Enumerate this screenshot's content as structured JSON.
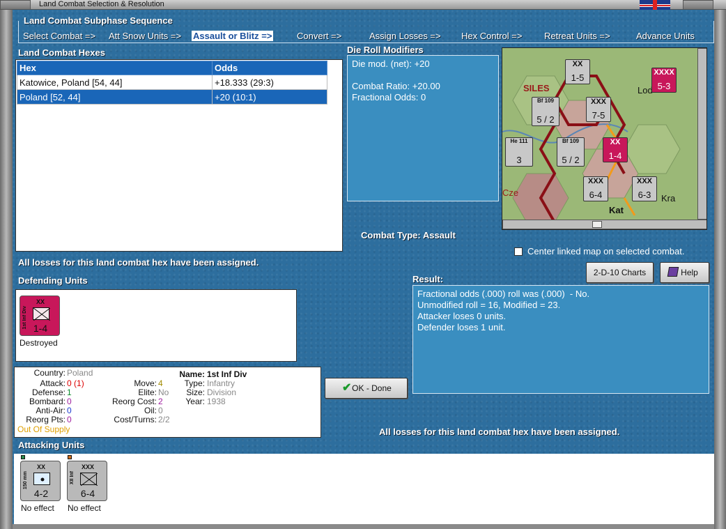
{
  "window": {
    "title": "Land Combat Selection & Resolution"
  },
  "sequence": {
    "title": "Land Combat Subphase Sequence",
    "steps": [
      "Select Combat =>",
      "Att Snow Units =>",
      "Assault or Blitz =>",
      "Convert =>",
      "Assign Losses =>",
      "Hex Control =>",
      "Retreat Units =>",
      "Advance Units"
    ],
    "active_step": "Assault or Blitz =>"
  },
  "hexes": {
    "title": "Land Combat Hexes",
    "columns": [
      "Hex",
      "Odds"
    ],
    "rows": [
      {
        "hex": "Katowice, Poland [54, 44]",
        "odds": "+18.333 (29:3)"
      },
      {
        "hex": "Poland [52, 44]",
        "odds": "+20 (10:1)"
      }
    ],
    "selected_row": 1
  },
  "die_roll": {
    "title": "Die Roll Modifiers",
    "net": "Die mod. (net): +20",
    "combat_ratio": "Combat Ratio: +20.00",
    "fractional": "Fractional Odds: 0"
  },
  "combat_type": "Combat Type:  Assault",
  "map": {
    "center_label": "Center linked map on selected combat.",
    "labels": [
      "SILES",
      "Lod",
      "Cze",
      "Kat",
      "Kra"
    ],
    "counters": [
      {
        "label": "XX",
        "value": "1-5"
      },
      {
        "label": "XXXX",
        "value": "5-3"
      },
      {
        "label": "XXX",
        "value": "7-5"
      },
      {
        "label": "XXX",
        "value": "6-4"
      },
      {
        "label": "XXX",
        "value": "6-3"
      },
      {
        "label": "XX",
        "value": "1-4"
      },
      {
        "label": "Bf 109",
        "value": "5 / 2"
      },
      {
        "label": "Bf 109",
        "value": "5 / 2"
      },
      {
        "label": "He 111",
        "value": "3"
      }
    ]
  },
  "status_msg": "All losses for this land combat hex have been assigned.",
  "buttons": {
    "charts": "2-D-10 Charts",
    "help": "Help",
    "ok": "OK - Done"
  },
  "defending": {
    "title": "Defending Units",
    "units": [
      {
        "name": "1st Inf Div",
        "size": "XX",
        "nation": "POL",
        "values": "1-4",
        "result": "Destroyed",
        "color": "#c8175a"
      }
    ]
  },
  "result": {
    "title": "Result:",
    "lines": [
      "Fractional odds (.000) roll was (.000)  - No.",
      "Unmodified roll = 16, Modified = 23.",
      "Attacker loses 0 units.",
      "Defender loses 1 unit."
    ]
  },
  "unit_details": {
    "country_label": "Country:",
    "country": "Poland",
    "attack_label": "Attack:",
    "attack": "0",
    "attack_extra": "(1)",
    "defense_label": "Defense:",
    "defense": "1",
    "bombard_label": "Bombard:",
    "bombard": "0",
    "antiair_label": "Anti-Air:",
    "antiair": "0",
    "reorg_label": "Reorg Pts:",
    "reorg": "0",
    "supply": "Out Of Supply",
    "move_label": "Move:",
    "move": "4",
    "elite_label": "Elite:",
    "elite": "No",
    "reorg_cost_label": "Reorg Cost:",
    "reorg_cost": "2",
    "oil_label": "Oil:",
    "oil": "0",
    "cost_label": "Cost/Turns:",
    "cost": "2/2",
    "name_label": "Name:",
    "name": "1st Inf Div",
    "type_label": "Type:",
    "type": "Infantry",
    "size_label": "Size:",
    "size": "Division",
    "year_label": "Year:",
    "year": "1938"
  },
  "status_msg2": "All losses for this land combat hex have been assigned.",
  "attacking": {
    "title": "Attacking Units",
    "units": [
      {
        "name": "150 mm",
        "size": "XX",
        "values": "4-2",
        "result": "No effect"
      },
      {
        "name": "XII Inf",
        "size": "XXX",
        "values": "6-4",
        "result": "No effect"
      }
    ]
  }
}
